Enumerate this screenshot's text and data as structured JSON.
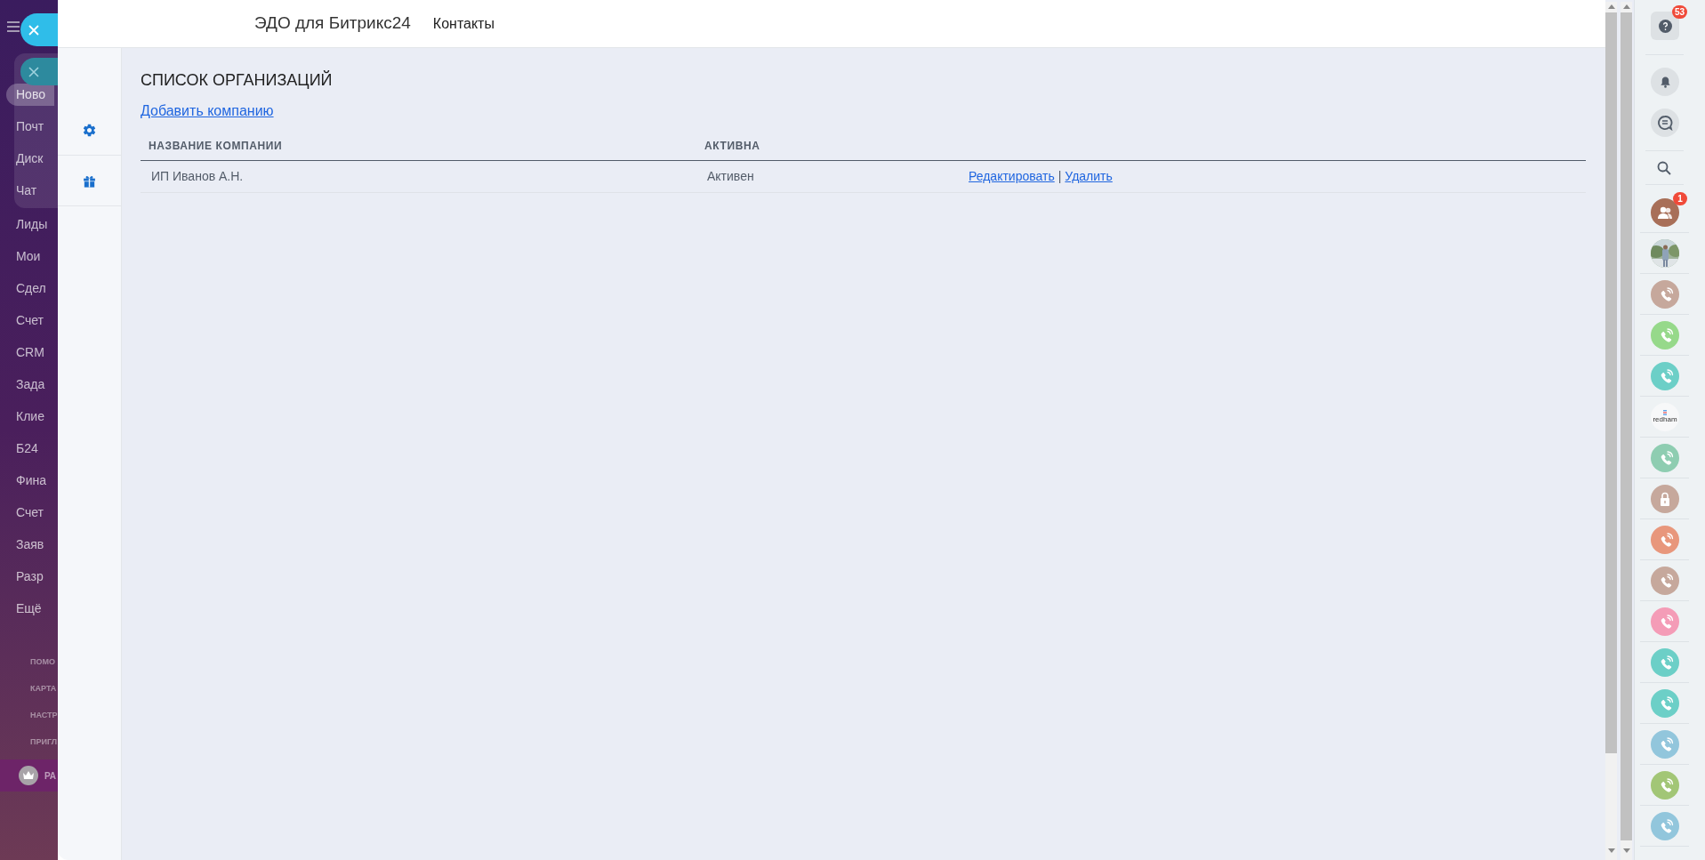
{
  "left_menu": {
    "group_items": [
      {
        "label": "Ново",
        "selected": true
      },
      {
        "label": "Почт",
        "selected": false
      },
      {
        "label": "Диск",
        "selected": false
      },
      {
        "label": "Чат",
        "selected": false
      }
    ],
    "items": [
      {
        "label": "Лиды",
        "selected": false
      },
      {
        "label": "Мои",
        "selected": false
      },
      {
        "label": "Сдел",
        "selected": false
      },
      {
        "label": "Счет",
        "selected": false
      },
      {
        "label": "CRM",
        "selected": false
      },
      {
        "label": "Зада",
        "selected": false
      },
      {
        "label": "Клие",
        "selected": false
      },
      {
        "label": "Б24",
        "selected": false
      },
      {
        "label": "Фина",
        "selected": false
      },
      {
        "label": "Счет",
        "selected": false
      },
      {
        "label": "Заяв",
        "selected": false
      },
      {
        "label": "Разр",
        "selected": false
      },
      {
        "label": "Ещё",
        "selected": false
      }
    ],
    "footer_items": [
      "ПОМО",
      "КАРТА",
      "НАСТР",
      "ПРИГЛ"
    ],
    "promo": "РА"
  },
  "header": {
    "app_title": "ЭДО для Битрикс24",
    "nav": [
      "Контакты"
    ]
  },
  "side_nav": [
    {
      "kind": "settings"
    },
    {
      "kind": "gift"
    }
  ],
  "page": {
    "title": "СПИСОК ОРГАНИЗАЦИЙ",
    "add_link": "Добавить компанию",
    "table": {
      "columns": [
        "НАЗВАНИЕ КОМПАНИИ",
        "АКТИВНА"
      ],
      "rows": [
        {
          "company": "ИП Иванов А.Н.",
          "status": "Активен",
          "actions": [
            "Редактировать",
            "Удалить"
          ],
          "separator": "|"
        }
      ]
    }
  },
  "right_sidebar": {
    "items": [
      {
        "kind": "help",
        "badge": "53"
      },
      {
        "kind": "bell"
      },
      {
        "kind": "chat"
      },
      {
        "kind": "search"
      },
      {
        "kind": "group",
        "badge": "1",
        "color": "#a86f58"
      },
      {
        "kind": "picture"
      },
      {
        "kind": "call",
        "color": "#c6a89c"
      },
      {
        "kind": "call",
        "color": "#96d98a"
      },
      {
        "kind": "call",
        "color": "#6ccfc7"
      },
      {
        "kind": "logo",
        "label": "redham"
      },
      {
        "kind": "call",
        "color": "#8ecdb1"
      },
      {
        "kind": "lock",
        "color": "#c6a89c"
      },
      {
        "kind": "call",
        "color": "#e8977c"
      },
      {
        "kind": "call",
        "color": "#c6a89c"
      },
      {
        "kind": "call",
        "color": "#f49cb7"
      },
      {
        "kind": "call",
        "color": "#6ccfc7"
      },
      {
        "kind": "call",
        "color": "#6ccfc7"
      },
      {
        "kind": "call",
        "color": "#92c6dc"
      },
      {
        "kind": "call",
        "color": "#a2c676"
      },
      {
        "kind": "call",
        "color": "#92c6dc"
      }
    ]
  }
}
